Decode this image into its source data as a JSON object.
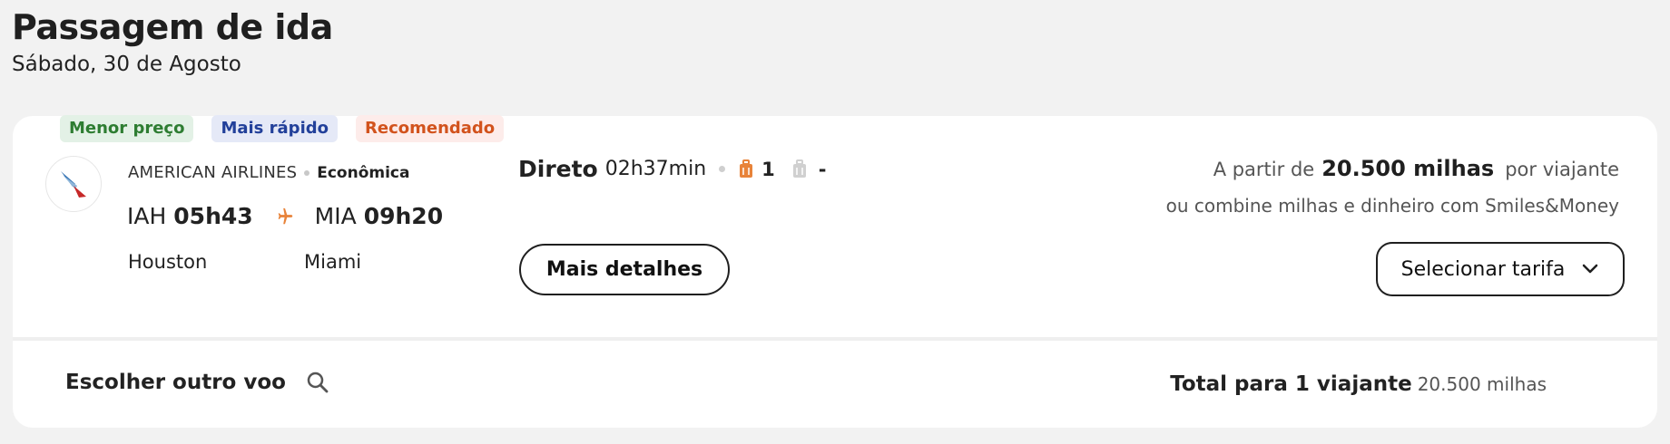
{
  "header": {
    "title": "Passagem de ida",
    "date": "Sábado, 30 de Agosto"
  },
  "flight": {
    "badges": {
      "cheapest": "Menor preço",
      "fastest": "Mais rápido",
      "recommended": "Recomendado"
    },
    "airline": "AMERICAN AIRLINES",
    "cabin": "Econômica",
    "origin": {
      "code": "IAH",
      "time": "05h43",
      "city": "Houston"
    },
    "destination": {
      "code": "MIA",
      "time": "09h20",
      "city": "Miami"
    },
    "stops": "Direto",
    "duration": "02h37min",
    "carry_on_count": "1",
    "checked_bag": "-",
    "details_button": "Mais detalhes",
    "price": {
      "prefix": "A partir de",
      "value": "20.500 milhas",
      "suffix": "por viajante",
      "combine_text": "ou combine milhas e dinheiro com Smiles&Money"
    },
    "select_fare_button": "Selecionar tarifa"
  },
  "footer": {
    "choose_other": "Escolher outro voo",
    "total_label": "Total para 1 viajante",
    "total_value": "20.500 milhas"
  },
  "colors": {
    "accent_orange": "#e8833a",
    "badge_green": "#2e7d32",
    "badge_blue": "#22409a",
    "badge_orange": "#d2531d"
  },
  "icons": [
    "american-airlines-logo",
    "airplane-icon",
    "carry-on-bag-icon",
    "checked-bag-icon",
    "chevron-down-icon",
    "search-icon"
  ]
}
